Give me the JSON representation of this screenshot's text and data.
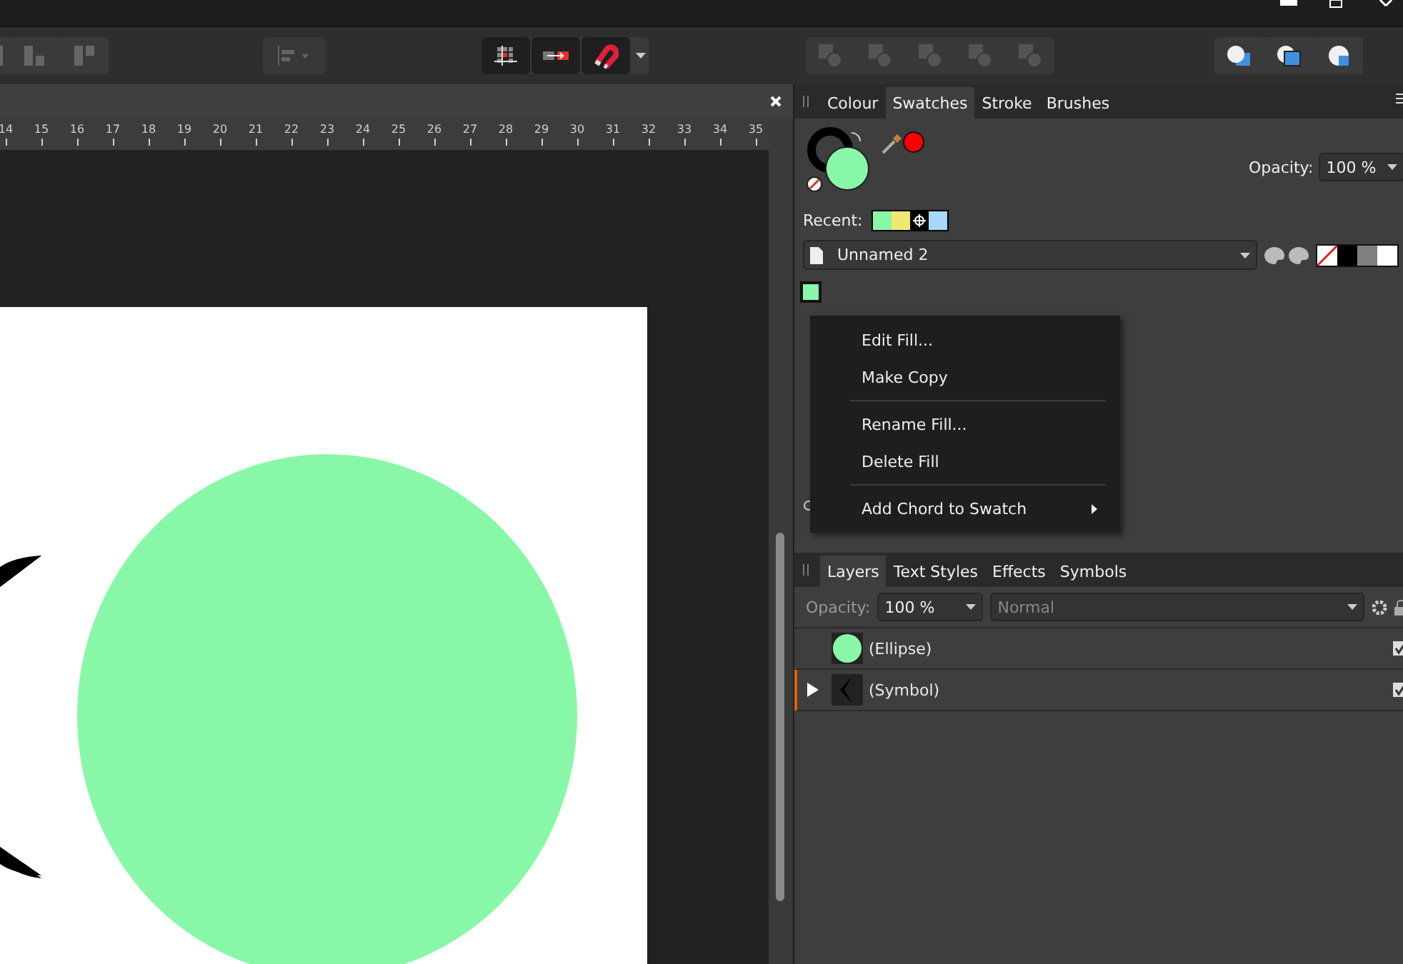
{
  "toolbar": {
    "arrange_buttons": [
      {
        "disabled": false
      },
      {
        "disabled": false
      },
      {
        "disabled": false
      }
    ],
    "align_button": {
      "disabled": true
    },
    "snapping_buttons": [
      {
        "kind": "grid"
      },
      {
        "kind": "move"
      },
      {
        "kind": "magnet"
      }
    ],
    "boolean_buttons": [
      {
        "disabled": true
      },
      {
        "disabled": true
      },
      {
        "disabled": true
      },
      {
        "disabled": true
      },
      {
        "disabled": true
      }
    ],
    "geometry_buttons": [
      {
        "kind": "front"
      },
      {
        "kind": "back"
      },
      {
        "kind": "intersect"
      }
    ]
  },
  "document": {
    "ruler_labels": [
      "14",
      "15",
      "16",
      "17",
      "18",
      "19",
      "20",
      "21",
      "22",
      "23",
      "24",
      "25",
      "26",
      "27",
      "28",
      "29",
      "30",
      "31",
      "32",
      "33",
      "34",
      "35"
    ]
  },
  "panel_tabs": [
    {
      "label": "Colour",
      "selected": false
    },
    {
      "label": "Swatches",
      "selected": true
    },
    {
      "label": "Stroke",
      "selected": false
    },
    {
      "label": "Brushes",
      "selected": false
    }
  ],
  "colour": {
    "opacity_label": "Opacity:",
    "opacity": "100 %"
  },
  "recent": {
    "label": "Recent:",
    "items": [
      {
        "kind": "color",
        "color": "#88f8a8"
      },
      {
        "kind": "color",
        "color": "#f0e870"
      },
      {
        "kind": "target",
        "color": "#000000"
      },
      {
        "kind": "color",
        "color": "#a8d8f8"
      }
    ]
  },
  "palette": {
    "value": "Unnamed 2"
  },
  "quick_swatches": [
    {
      "kind": "none"
    },
    {
      "kind": "color",
      "color": "#000000"
    },
    {
      "kind": "color",
      "color": "#808080"
    },
    {
      "kind": "color",
      "color": "#ffffff"
    }
  ],
  "swatches": [
    {
      "color": "#88f8a8",
      "selected": true
    }
  ],
  "context_menu": [
    {
      "kind": "item",
      "label": "Edit Fill..."
    },
    {
      "kind": "item",
      "label": "Make Copy"
    },
    {
      "kind": "separator"
    },
    {
      "kind": "item",
      "label": "Rename Fill..."
    },
    {
      "kind": "item",
      "label": "Delete Fill"
    },
    {
      "kind": "separator"
    },
    {
      "kind": "submenu",
      "label": "Add Chord to Swatch"
    }
  ],
  "layer_tabs": [
    {
      "label": "Layers",
      "selected": true
    },
    {
      "label": "Text Styles",
      "selected": false
    },
    {
      "label": "Effects",
      "selected": false
    },
    {
      "label": "Symbols",
      "selected": false
    }
  ],
  "layers": {
    "opacity_label": "Opacity:",
    "opacity": "100 %",
    "blend": "Normal",
    "rows": [
      {
        "kind": "ellipse",
        "name": "(Ellipse)",
        "visible": true,
        "expandable": false
      },
      {
        "kind": "symbol",
        "name": "(Symbol)",
        "visible": true,
        "expandable": true
      }
    ]
  }
}
